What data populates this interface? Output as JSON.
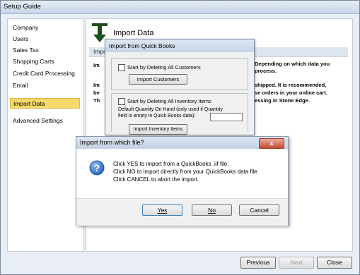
{
  "window": {
    "title": "Setup Guide"
  },
  "sidebar": {
    "items": [
      {
        "label": "Company",
        "selected": false
      },
      {
        "label": "Users",
        "selected": false
      },
      {
        "label": "Sales Tax",
        "selected": false
      },
      {
        "label": "Shopping Carts",
        "selected": false
      },
      {
        "label": "Credit Card Processing",
        "selected": false
      },
      {
        "label": "Email",
        "selected": false
      },
      {
        "label": "Import Data",
        "selected": true
      },
      {
        "label": "Advanced Settings",
        "selected": false
      }
    ]
  },
  "main": {
    "title": "Import Data",
    "band_label": "Impo",
    "bg_text": {
      "l1": "Im",
      "r1": "Depending on which data you",
      "r2": "process.",
      "l3": "Im",
      "l4": "be",
      "l5": "Th",
      "r3": "shipped.  It is recommended,",
      "r4": "se orders in your online cart.",
      "r5": "essing in Stone Edge."
    }
  },
  "qb_dialog": {
    "title": "Import from Quick Books",
    "customers_checkbox_label": "Start by Deleting All Customers",
    "import_customers_button": "Import Customers",
    "inventory_checkbox_label": "Start by Deleting All Inventory Items",
    "default_qty_line1": "Default Quantity On Hand (only used if Quantity",
    "default_qty_line2": "field is empty in Quick Books data):",
    "import_inventory_button": "Import Inventory Items"
  },
  "file_dialog": {
    "title": "Import from which file?",
    "close_glyph": "x",
    "messages": [
      "Click YES to import from a QuickBooks .iif file.",
      "Click NO to import directly from your QuickBooks data file.",
      "Click CANCEL to abort the import."
    ],
    "yes_label": "Yes",
    "no_label": "No",
    "cancel_label": "Cancel"
  },
  "footer": {
    "previous_label": "Previous",
    "next_label": "Next",
    "close_label": "Close"
  }
}
